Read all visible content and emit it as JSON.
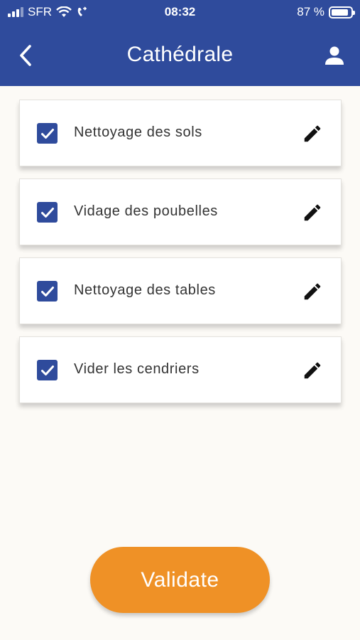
{
  "status_bar": {
    "carrier": "SFR",
    "time": "08:32",
    "battery": "87 %",
    "battery_level": 0.87
  },
  "header": {
    "title": "Cathédrale",
    "back_icon": "chevron-left-icon",
    "user_icon": "person-icon"
  },
  "tasks": [
    {
      "label": "Nettoyage des sols",
      "checked": true
    },
    {
      "label": "Vidage des poubelles",
      "checked": true
    },
    {
      "label": "Nettoyage des tables",
      "checked": true
    },
    {
      "label": "Vider les cendriers",
      "checked": true
    }
  ],
  "validate_label": "Validate",
  "colors": {
    "primary": "#2f4b9c",
    "accent": "#ef9126",
    "background": "#fcfaf6"
  }
}
